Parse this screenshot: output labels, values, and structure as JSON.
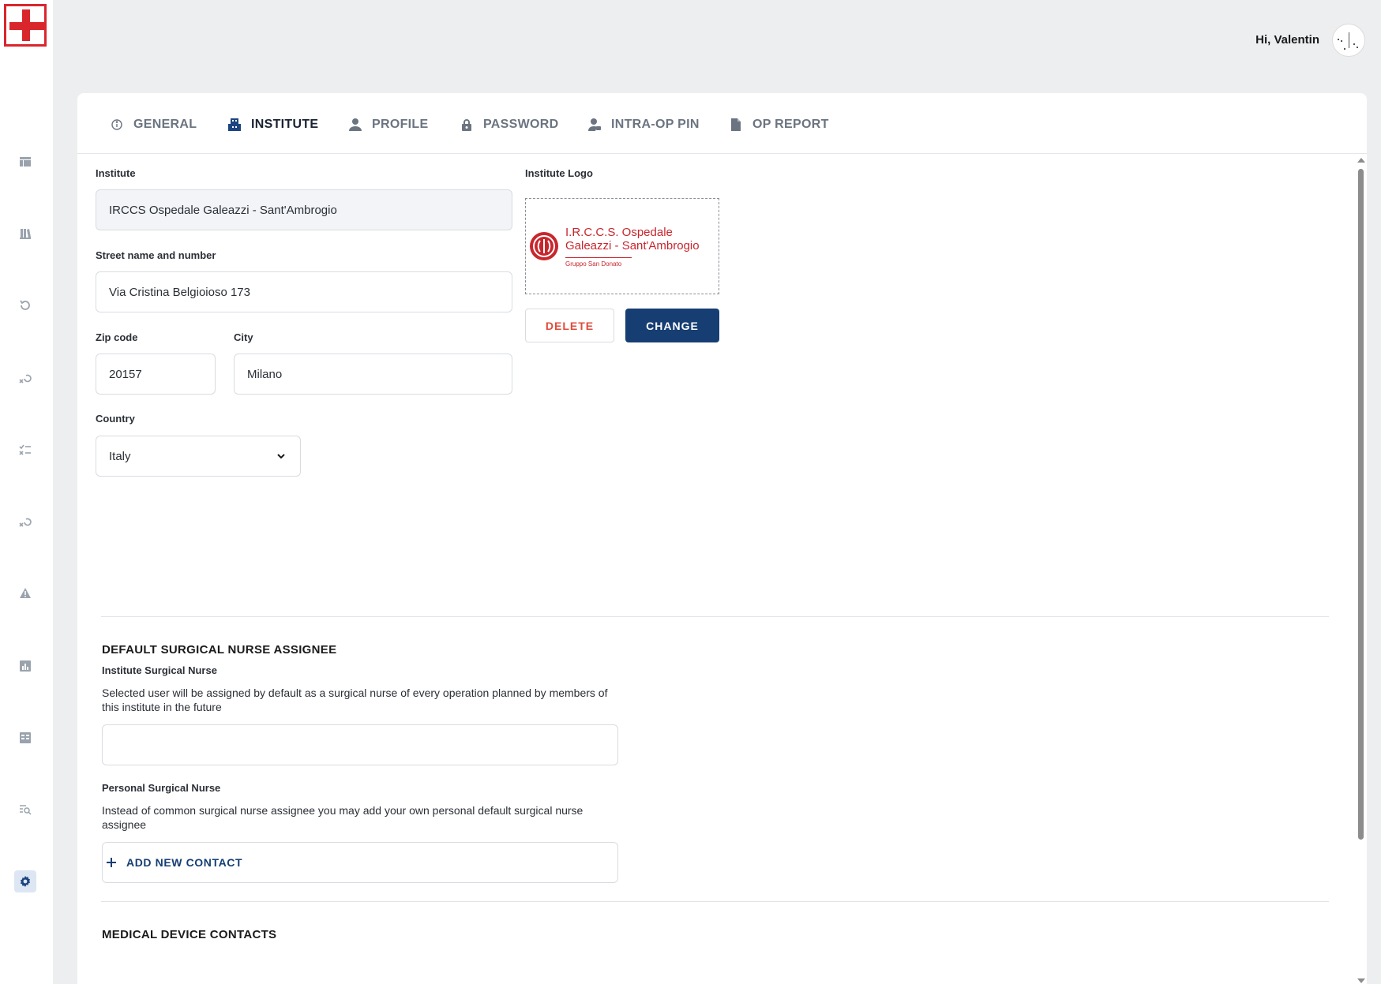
{
  "header": {
    "greeting": "Hi, Valentin"
  },
  "tabs": [
    {
      "label": "GENERAL",
      "icon": "info-icon",
      "active": false
    },
    {
      "label": "INSTITUTE",
      "icon": "building-icon",
      "active": true
    },
    {
      "label": "PROFILE",
      "icon": "person-icon",
      "active": false
    },
    {
      "label": "PASSWORD",
      "icon": "lock-icon",
      "active": false
    },
    {
      "label": "INTRA-OP PIN",
      "icon": "person-key-icon",
      "active": false
    },
    {
      "label": "OP REPORT",
      "icon": "document-icon",
      "active": false
    }
  ],
  "institute": {
    "institute_label": "Institute",
    "institute_value": "IRCCS Ospedale Galeazzi - Sant'Ambrogio",
    "street_label": "Street name and number",
    "street_value": "Via Cristina Belgioioso 173",
    "zip_label": "Zip code",
    "zip_value": "20157",
    "city_label": "City",
    "city_value": "Milano",
    "country_label": "Country",
    "country_value": "Italy",
    "logo_label": "Institute Logo",
    "logo_line1": "I.R.C.C.S. Ospedale",
    "logo_line2": "Galeazzi - Sant'Ambrogio",
    "logo_line3": "Gruppo San Donato",
    "delete_label": "DELETE",
    "change_label": "CHANGE"
  },
  "nurse": {
    "section_title": "DEFAULT SURGICAL NURSE ASSIGNEE",
    "institute_label": "Institute Surgical Nurse",
    "institute_desc": "Selected user will be assigned by default as a surgical nurse of every operation planned by members of this institute in the future",
    "institute_value": "",
    "personal_label": "Personal Surgical Nurse",
    "personal_desc": "Instead of common surgical nurse assignee you may add your own personal default surgical nurse assignee",
    "personal_value": ""
  },
  "contacts": {
    "section_title": "MEDICAL DEVICE CONTACTS",
    "add_label": "ADD NEW CONTACT"
  },
  "colors": {
    "brand_red": "#d9262c",
    "primary_blue": "#163e73",
    "delete_red": "#e04b3a"
  },
  "sidebar_icons": [
    "dashboard-icon",
    "library-icon",
    "history-icon",
    "undo-cross-icon",
    "checklist-icon",
    "undo-cross-icon",
    "warning-icon",
    "stats-icon",
    "table-icon",
    "search-list-icon",
    "settings-icon"
  ]
}
